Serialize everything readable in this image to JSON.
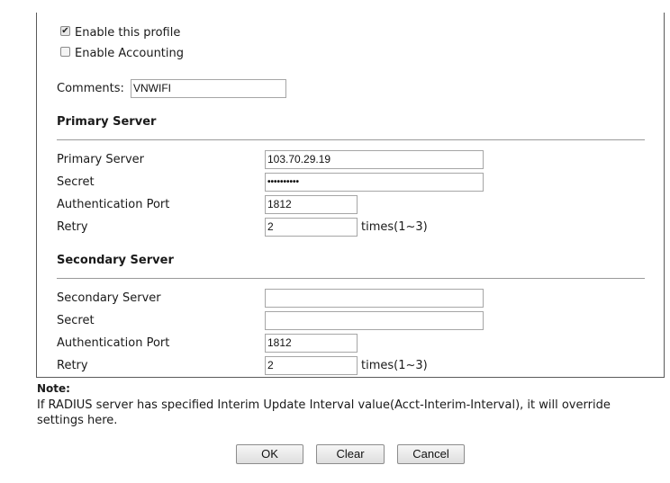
{
  "profile": {
    "enable_label": "Enable this profile",
    "enable_checked": true,
    "accounting_label": "Enable Accounting",
    "accounting_checked": false,
    "comments_label": "Comments:",
    "comments_value": "VNWIFI"
  },
  "primary": {
    "section_title": "Primary Server",
    "server_label": "Primary Server",
    "server_value": "103.70.29.19",
    "secret_label": "Secret",
    "secret_value": "••••••••••",
    "port_label": "Authentication Port",
    "port_value": "1812",
    "retry_label": "Retry",
    "retry_value": "2",
    "retry_suffix": "times(1~3)"
  },
  "secondary": {
    "section_title": "Secondary Server",
    "server_label": "Secondary Server",
    "server_value": "",
    "secret_label": "Secret",
    "secret_value": "",
    "port_label": "Authentication Port",
    "port_value": "1812",
    "retry_label": "Retry",
    "retry_value": "2",
    "retry_suffix": "times(1~3)"
  },
  "note": {
    "title": "Note:",
    "text": "If RADIUS server has specified Interim Update Interval value(Acct-Interim-Interval), it will override settings here."
  },
  "buttons": {
    "ok": "OK",
    "clear": "Clear",
    "cancel": "Cancel"
  },
  "icons": {
    "checkmark": "checkmark-icon"
  }
}
